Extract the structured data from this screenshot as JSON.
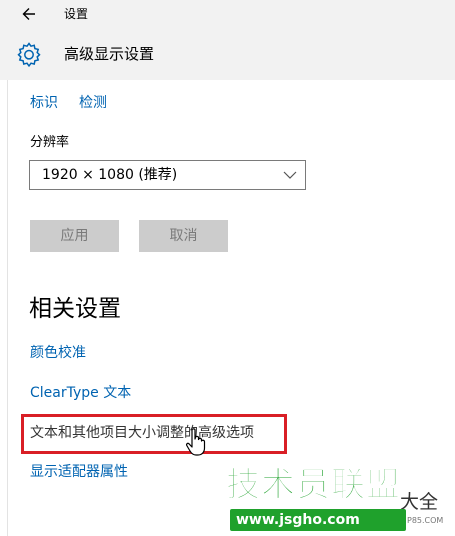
{
  "window": {
    "title": "设置"
  },
  "header": {
    "icon": "gear-icon",
    "title": "高级显示设置"
  },
  "top_links": [
    "标识",
    "检测"
  ],
  "resolution": {
    "label": "分辨率",
    "selected": "1920 × 1080 (推荐)"
  },
  "buttons": {
    "apply": "应用",
    "cancel": "取消"
  },
  "related": {
    "heading": "相关设置",
    "links": [
      "颜色校准",
      "ClearType 文本",
      "文本和其他项目大小调整的高级选项",
      "显示适配器属性"
    ]
  },
  "watermark": {
    "main": "技术员联盟",
    "url": "www.jsgho.com",
    "side": "大全",
    "small": "P85.COM"
  },
  "colors": {
    "link": "#0063b1",
    "highlight_border": "#d91f26",
    "watermark_green": "#1fa12c",
    "header_bg": "#f2f2f2",
    "disabled_button_bg": "#cccccc"
  }
}
